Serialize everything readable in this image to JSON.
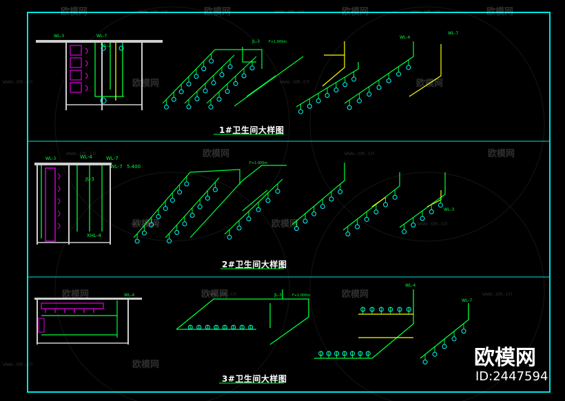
{
  "colors": {
    "background": "#000000",
    "frame": "#00e5e5",
    "pipe_green": "#00ff3a",
    "pipe_yellow": "#ffff00",
    "fixture_magenta": "#e000e0",
    "node_cyan": "#00ffff",
    "wall_white": "#cfcfcf"
  },
  "panels": [
    {
      "title": "1#卫生间大样图"
    },
    {
      "title": "2#卫生间大样图"
    },
    {
      "title": "3#卫生间大样图"
    }
  ],
  "pipe_labels": {
    "p1": [
      "WL-3",
      "WL-7",
      "WL-2",
      "JL-3",
      "WL-4",
      "WL-7"
    ],
    "p2": [
      "WL-3",
      "WL-4",
      "WL-7",
      "JL-3",
      "XHL-4",
      "WL-7",
      "WL-3"
    ],
    "p3": [
      "WL-4",
      "JL-3",
      "WL-4",
      "WL-7"
    ]
  },
  "dimensions": {
    "elevation_small": "5.400",
    "floor_mark": "F+1.000m"
  },
  "watermark": {
    "brand": "欧模网",
    "url": "www.om.cn",
    "id": "ID:2447594"
  }
}
